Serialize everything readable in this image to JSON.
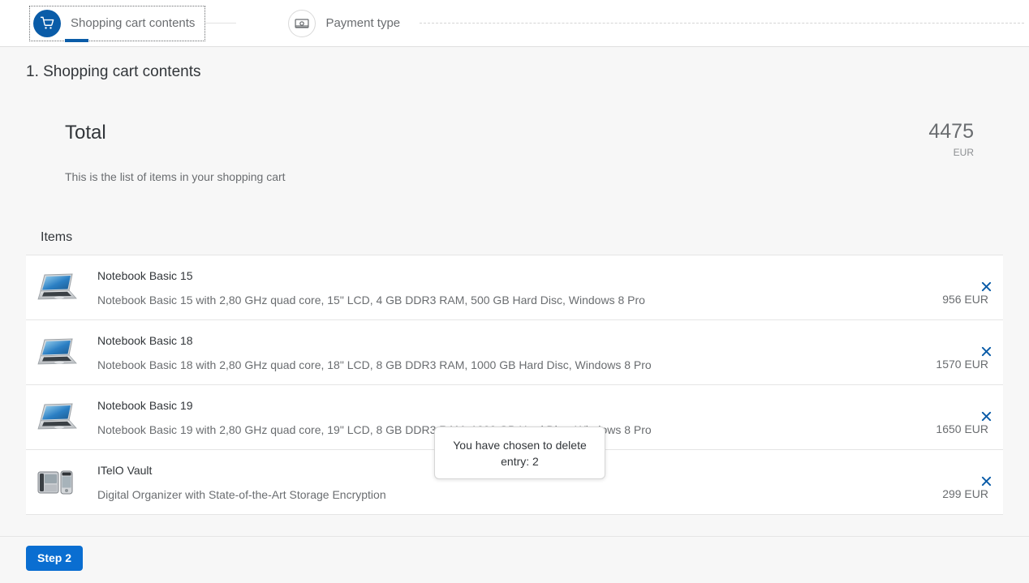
{
  "wizard": {
    "steps": [
      {
        "label": "Shopping cart contents",
        "icon": "cart-icon",
        "state": "active"
      },
      {
        "label": "Payment type",
        "icon": "banknote-icon",
        "state": "inactive"
      }
    ]
  },
  "page": {
    "title": "1. Shopping cart contents"
  },
  "total": {
    "heading": "Total",
    "subtitle": "This is the list of items in your shopping cart",
    "amount": "4475",
    "currency": "EUR"
  },
  "items_section": {
    "heading": "Items",
    "delete_icon": "close-icon",
    "rows": [
      {
        "title": "Notebook Basic 15",
        "description": "Notebook Basic 15 with 2,80 GHz quad core, 15\" LCD, 4 GB DDR3 RAM, 500 GB Hard Disc, Windows 8 Pro",
        "price": "956 EUR",
        "thumb": "laptop-icon"
      },
      {
        "title": "Notebook Basic 18",
        "description": "Notebook Basic 18 with 2,80 GHz quad core, 18\" LCD, 8 GB DDR3 RAM, 1000 GB Hard Disc, Windows 8 Pro",
        "price": "1570 EUR",
        "thumb": "laptop-icon"
      },
      {
        "title": "Notebook Basic 19",
        "description": "Notebook Basic 19 with 2,80 GHz quad core, 19\" LCD, 8 GB DDR3 RAM, 1000 GB Hard Disc, Windows 8 Pro",
        "price": "1650 EUR",
        "thumb": "laptop-icon"
      },
      {
        "title": "ITelO Vault",
        "description": "Digital Organizer with State-of-the-Art Storage Encryption",
        "price": "299 EUR",
        "thumb": "organizer-icon"
      }
    ]
  },
  "popover": {
    "message": "You have chosen to delete entry: 2"
  },
  "footer": {
    "step_button_label": "Step 2"
  },
  "colors": {
    "accent_blue": "#0a6ed1",
    "step_blue": "#0a5ca8",
    "text_dark": "#32363a",
    "text_muted": "#6a6d70",
    "page_bg": "#f7f7f7"
  }
}
